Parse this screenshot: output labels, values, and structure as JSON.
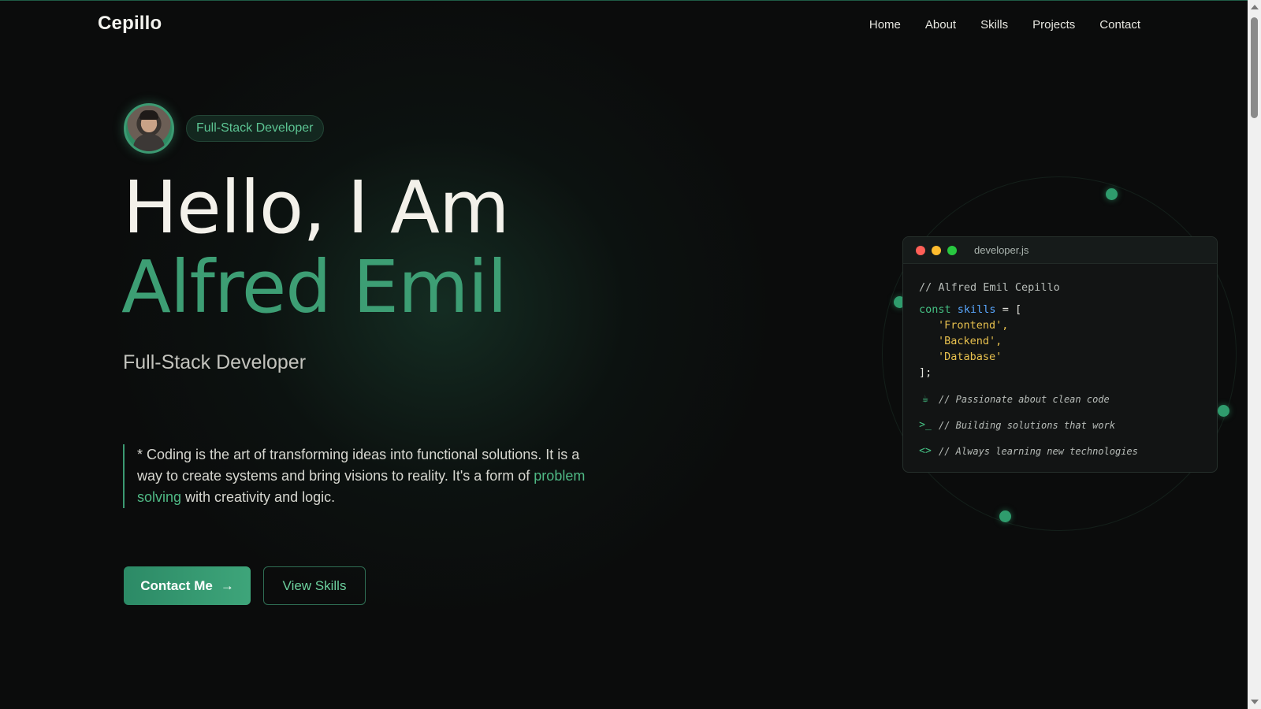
{
  "brand": "Cepillo",
  "nav": {
    "items": [
      "Home",
      "About",
      "Skills",
      "Projects",
      "Contact"
    ]
  },
  "hero": {
    "badge": "Full-Stack Developer",
    "greeting": "Hello, I Am",
    "name": "Alfred Emil",
    "subtitle": "Full-Stack Developer",
    "quote_pre": "* Coding is the art of transforming ideas into functional solutions. It is a way to create systems and bring visions to reality. It's a form of ",
    "quote_highlight": "problem solving",
    "quote_post": " with creativity and logic.",
    "primary_button": "Contact Me",
    "secondary_button": "View Skills",
    "arrow_icon": "→"
  },
  "code_card": {
    "filename": "developer.js",
    "comment": "// Alfred Emil Cepillo",
    "keyword": "const",
    "variable": "skills",
    "open": " = [",
    "strings": [
      "'Frontend',",
      "'Backend',",
      "'Database'"
    ],
    "close": "];",
    "notes": [
      {
        "icon": "coffee-icon",
        "glyph": "☕",
        "text": "// Passionate about clean code"
      },
      {
        "icon": "terminal-icon",
        "glyph": ">_",
        "text": "// Building solutions that work"
      },
      {
        "icon": "code-icon",
        "glyph": "<>",
        "text": "// Always learning new technologies"
      }
    ]
  },
  "colors": {
    "accent": "#3d9e74",
    "background": "#0b0c0c",
    "traffic_red": "#ff5f57",
    "traffic_yellow": "#febc2e",
    "traffic_green": "#28c840"
  }
}
